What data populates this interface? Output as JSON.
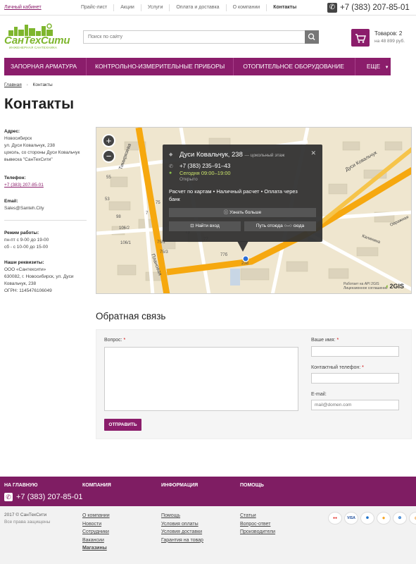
{
  "topbar": {
    "account_link": "Личный кабинет",
    "nav": [
      "Прайс-лист",
      "Акции",
      "Услуги",
      "Оплата и доставка",
      "О компании",
      "Контакты"
    ],
    "phone": "+7 (383) 207-85-01"
  },
  "header": {
    "logo_text": "СанТехСити",
    "logo_subtitle": "ИНЖЕНЕРНАЯ САНТЕХНИКА",
    "search_placeholder": "Поиск по сайту",
    "cart_label": "Товаров: 2",
    "cart_sum": "на 48 899 руб."
  },
  "menu": [
    "ЗАПОРНАЯ АРМАТУРА",
    "КОНТРОЛЬНО-ИЗМЕРИТЕЛЬНЫЕ ПРИБОРЫ",
    "ОТОПИТЕЛЬНОЕ ОБОРУДОВАНИЕ",
    "ЕЩЕ"
  ],
  "breadcrumb": {
    "home": "Главная",
    "current": "Контакты"
  },
  "page_title": "Контакты",
  "info": {
    "address_label": "Адрес:",
    "address_lines": [
      "Новосибирск",
      "ул. Дуси Ковальчук, 238",
      "цоколь, со стороны Дуси Ковальчук",
      "вывеска \"СанТехСити\""
    ],
    "phone_label": "Телефон:",
    "phone": "+7 (383) 207-85-01",
    "email_label": "Email:",
    "email": "Sales@Santeh.City",
    "hours_label": "Режим работы:",
    "hours_lines": [
      "пн-пт с 9-00 до 19-00",
      "сб - с 10-00 до 15-00"
    ],
    "req_label": "Наши реквизиты:",
    "req_lines": [
      "ООО «Сантехсити»",
      "630082, г. Новосибирск, ул. Дуси",
      "Ковальчук, 238",
      "ОГРН: 1145476106049"
    ]
  },
  "map": {
    "zoom_in": "+",
    "zoom_out": "−",
    "popup_title": "Дуси Ковальчук, 238",
    "popup_floor": "— цокольный этаж",
    "popup_phone": "+7 (383) 235–91–43",
    "popup_hours": "Сегодня 09:00–19:00",
    "popup_status": "Открыто",
    "popup_payment": "Расчет по картам • Наличный расчет • Оплата через банк",
    "popup_more": "Узнать больше",
    "popup_login": "Найти вход",
    "popup_route_from": "Путь отсюда",
    "popup_route_to": "сюда",
    "labels": [
      "Тимирязева",
      "Плановая",
      "Дуси Ковальчук",
      "Калинина",
      "Овражная"
    ],
    "house_numbers": [
      "55",
      "53",
      "75",
      "7",
      "98",
      "106/2",
      "106/1",
      "73",
      "75/1",
      "75/3",
      "77",
      "77б",
      "238"
    ],
    "api_note": "Работает на API 2GIS",
    "license_note": "Лицензионное соглашение",
    "provider": "2GIS"
  },
  "feedback": {
    "title": "Обратная связь",
    "question_label": "Вопрос:",
    "name_label": "Ваше имя:",
    "phone_label": "Контактный телефон:",
    "email_label": "E-mail:",
    "email_placeholder": "mail@domen.com",
    "submit": "ОТПРАВИТЬ"
  },
  "footer": {
    "cols": [
      "НА ГЛАВНУЮ",
      "КОМПАНИЯ",
      "ИНФОРМАЦИЯ",
      "ПОМОЩЬ"
    ],
    "phone": "+7 (383) 207-85-01",
    "copyright": "2017 © СанТехСити",
    "rights": "Все права защищены",
    "company_links": [
      "О компании",
      "Новости",
      "Сотрудники",
      "Вакансии",
      "Магазины"
    ],
    "info_links": [
      "Помощь",
      "Условия оплаты",
      "Условия доставки",
      "Гарантия на товар"
    ],
    "help_links": [
      "Статьи",
      "Вопрос-ответ",
      "Производители"
    ],
    "payment_methods": [
      "MasterCard",
      "VISA",
      "Webmoney",
      "Yandex",
      "Qiwi",
      "Sberbank"
    ]
  },
  "colors": {
    "brand": "#8b1d6b",
    "footer": "#7f1d63",
    "logo_green": "#7eb62e"
  }
}
